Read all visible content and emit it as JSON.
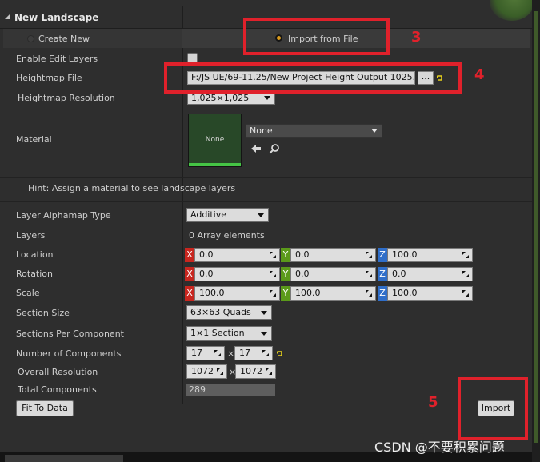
{
  "panel": {
    "title": "New Landscape",
    "mode_create": "Create New",
    "mode_import": "Import from File"
  },
  "rows": {
    "enable_edit_layers": "Enable Edit Layers",
    "heightmap_file": "Heightmap File",
    "heightmap_file_value": "F:/JS UE/69-11.25/New Project Height Output 1025.png",
    "browse_label": "...",
    "heightmap_resolution": "Heightmap Resolution",
    "heightmap_resolution_value": "1,025×1,025",
    "material": "Material",
    "material_thumb_text": "None",
    "material_value": "None",
    "hint": "Hint: Assign a material to see landscape layers",
    "layer_alphamap_type": "Layer Alphamap Type",
    "layer_alphamap_value": "Additive",
    "layers": "Layers",
    "layers_value": "0 Array elements",
    "location": "Location",
    "rotation": "Rotation",
    "scale": "Scale",
    "section_size": "Section Size",
    "section_size_value": "63×63 Quads",
    "sections_per_component": "Sections Per Component",
    "sections_per_component_value": "1×1 Section",
    "number_of_components": "Number of Components",
    "number_of_components_x": "17",
    "number_of_components_y": "17",
    "overall_resolution": "Overall Resolution",
    "overall_resolution_x": "1072",
    "overall_resolution_y": "1072",
    "total_components": "Total Components",
    "total_components_value": "289",
    "times": "×"
  },
  "vectors": {
    "axis_x": "X",
    "axis_y": "Y",
    "axis_z": "Z",
    "location": [
      "0.0",
      "0.0",
      "100.0"
    ],
    "rotation": [
      "0.0",
      "0.0",
      "0.0"
    ],
    "scale": [
      "100.0",
      "100.0",
      "100.0"
    ]
  },
  "buttons": {
    "fit_to_data": "Fit To Data",
    "import": "Import"
  },
  "annotations": {
    "n3": "3",
    "n4": "4",
    "n5": "5"
  },
  "watermark": "CSDN @不要积累问题",
  "colors": {
    "accent_radio": "#d99a1c",
    "annotation_red": "#e0212b",
    "axis_x": "#c8261f",
    "axis_y": "#5b9a1a",
    "axis_z": "#2f6ec9"
  }
}
